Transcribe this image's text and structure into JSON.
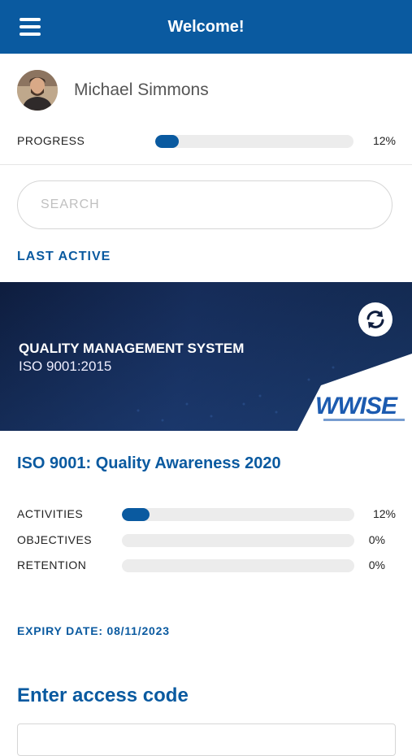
{
  "header": {
    "title": "Welcome!",
    "menu_icon": "hamburger-menu-icon"
  },
  "user": {
    "name": "Michael Simmons"
  },
  "progress": {
    "label": "PROGRESS",
    "value_text": "12%",
    "fraction": 0.12
  },
  "search": {
    "placeholder": "SEARCH",
    "value": ""
  },
  "last_active_label": "LAST ACTIVE",
  "banner": {
    "title": "QUALITY MANAGEMENT SYSTEM",
    "subtitle": "ISO 9001:2015",
    "logo_text": "WWISE",
    "refresh_icon": "refresh-icon"
  },
  "course": {
    "title": "ISO 9001: Quality Awareness 2020",
    "stats": [
      {
        "label": "ACTIVITIES",
        "value_text": "12%",
        "fraction": 0.12
      },
      {
        "label": "OBJECTIVES",
        "value_text": "0%",
        "fraction": 0
      },
      {
        "label": "RETENTION",
        "value_text": "0%",
        "fraction": 0
      }
    ],
    "expiry": "EXPIRY DATE: 08/11/2023"
  },
  "access": {
    "title": "Enter access code",
    "value": ""
  },
  "colors": {
    "brand": "#0a5aa0",
    "track": "#ececec",
    "banner": "#13264f"
  }
}
